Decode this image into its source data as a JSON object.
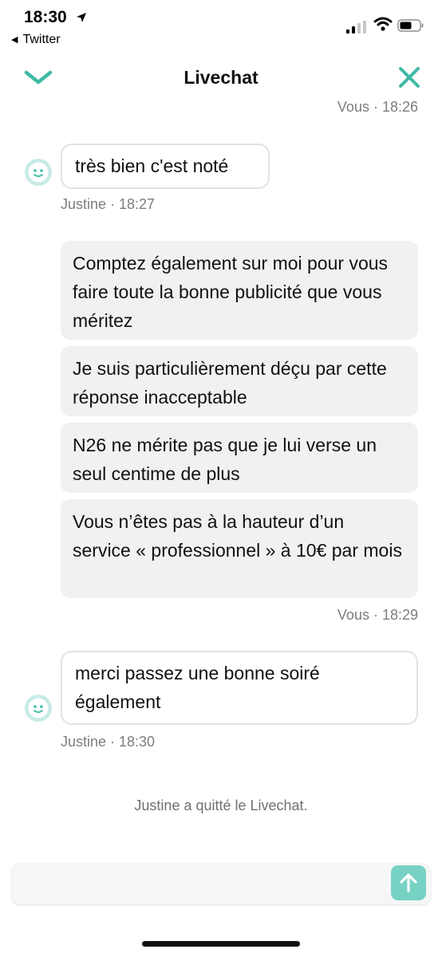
{
  "status_bar": {
    "time": "18:30",
    "back_app": "Twitter"
  },
  "header": {
    "title": "Livechat",
    "left_icon": "chevron-down-icon",
    "right_icon": "close-icon",
    "accent_color": "#3fb9a5"
  },
  "messages": {
    "prev_meta": "Vous · 18:26",
    "in1": {
      "text": "très bien c'est noté",
      "meta": "Justine · 18:27"
    },
    "out": [
      "Comptez également sur moi pour vous faire toute la bonne publicité que vous méritez",
      "Je suis particulièrement déçu par cette réponse inacceptable",
      "N26 ne mérite pas que je lui verse un seul centime de plus",
      "Vous n’êtes pas à la hauteur d’un service « professionnel » à 10€ par mois"
    ],
    "out_meta": "Vous · 18:29",
    "in2": {
      "text": "merci passez une bonne soiré également",
      "meta": "Justine · 18:30"
    }
  },
  "system_message": "Justine a quitté le Livechat.",
  "composer": {
    "send_icon": "arrow-up-icon",
    "send_color": "#77d2c4"
  }
}
